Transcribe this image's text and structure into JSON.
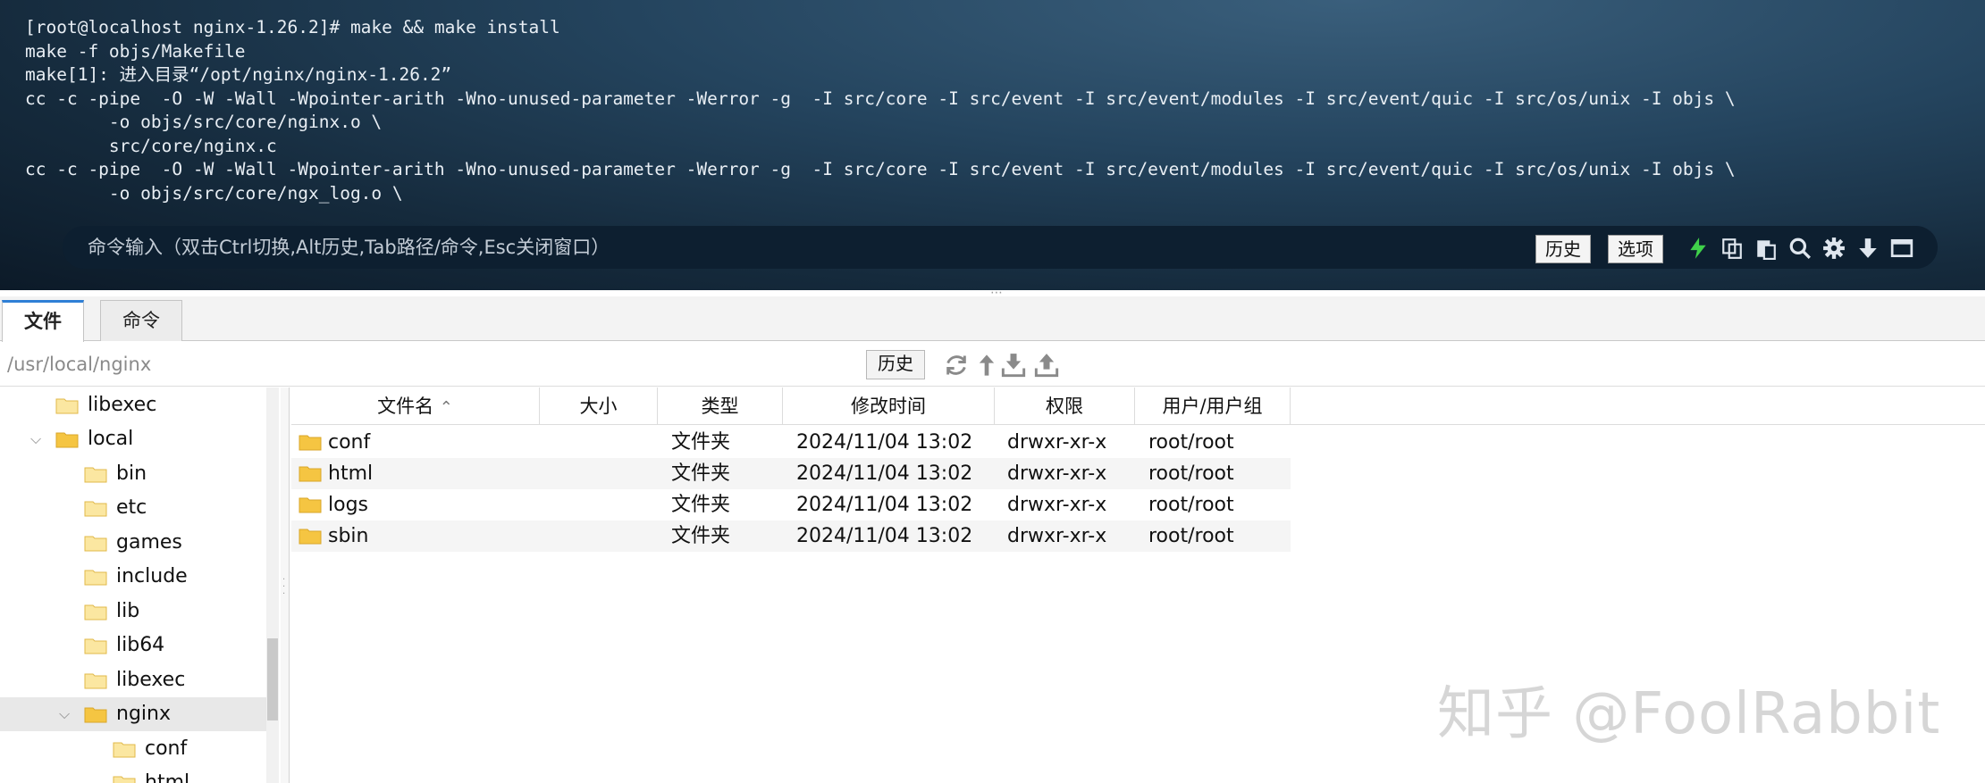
{
  "terminal": {
    "lines": [
      "[root@localhost nginx-1.26.2]# make && make install",
      "make -f objs/Makefile",
      "make[1]: 进入目录“/opt/nginx/nginx-1.26.2”",
      "cc -c -pipe  -O -W -Wall -Wpointer-arith -Wno-unused-parameter -Werror -g  -I src/core -I src/event -I src/event/modules -I src/event/quic -I src/os/unix -I objs \\",
      "        -o objs/src/core/nginx.o \\",
      "        src/core/nginx.c",
      "cc -c -pipe  -O -W -Wall -Wpointer-arith -Wno-unused-parameter -Werror -g  -I src/core -I src/event -I src/event/modules -I src/event/quic -I src/os/unix -I objs \\",
      "        -o objs/src/core/ngx_log.o \\"
    ],
    "command_placeholder": "命令输入（双击Ctrl切换,Alt历史,Tab路径/命令,Esc关闭窗口）",
    "history_label": "历史",
    "options_label": "选项",
    "icons": [
      "lightning-icon",
      "copy-icon",
      "paste-icon",
      "search-icon",
      "gear-icon",
      "down-arrow-icon",
      "window-icon"
    ]
  },
  "tabs": [
    {
      "label": "文件",
      "active": true
    },
    {
      "label": "命令",
      "active": false
    }
  ],
  "pathbar": {
    "path": "/usr/local/nginx",
    "history_label": "历史",
    "icons": [
      "refresh-icon",
      "up-icon",
      "download-icon",
      "upload-icon"
    ]
  },
  "tree": {
    "items": [
      {
        "label": "libexec",
        "expanded": null,
        "selected": false
      },
      {
        "label": "local",
        "expanded": true,
        "selected": false
      },
      {
        "label": "bin",
        "expanded": null,
        "selected": false
      },
      {
        "label": "etc",
        "expanded": null,
        "selected": false
      },
      {
        "label": "games",
        "expanded": null,
        "selected": false
      },
      {
        "label": "include",
        "expanded": null,
        "selected": false
      },
      {
        "label": "lib",
        "expanded": null,
        "selected": false
      },
      {
        "label": "lib64",
        "expanded": null,
        "selected": false
      },
      {
        "label": "libexec",
        "expanded": null,
        "selected": false
      },
      {
        "label": "nginx",
        "expanded": true,
        "selected": true
      },
      {
        "label": "conf",
        "expanded": null,
        "selected": false
      },
      {
        "label": "html",
        "expanded": null,
        "selected": false
      }
    ]
  },
  "filelist": {
    "columns": [
      "文件名",
      "大小",
      "类型",
      "修改时间",
      "权限",
      "用户/用户组"
    ],
    "sort_indicator": "^",
    "rows": [
      {
        "name": "conf",
        "size": "",
        "type": "文件夹",
        "mtime": "2024/11/04 13:02",
        "perm": "drwxr-xr-x",
        "owner": "root/root"
      },
      {
        "name": "html",
        "size": "",
        "type": "文件夹",
        "mtime": "2024/11/04 13:02",
        "perm": "drwxr-xr-x",
        "owner": "root/root"
      },
      {
        "name": "logs",
        "size": "",
        "type": "文件夹",
        "mtime": "2024/11/04 13:02",
        "perm": "drwxr-xr-x",
        "owner": "root/root"
      },
      {
        "name": "sbin",
        "size": "",
        "type": "文件夹",
        "mtime": "2024/11/04 13:02",
        "perm": "drwxr-xr-x",
        "owner": "root/root"
      }
    ]
  },
  "watermark": "知乎 @FoolRabbit",
  "colors": {
    "folder": "#f5c542",
    "active_tab_accent": "#2f7fd6",
    "lightning": "#3fd14a"
  }
}
